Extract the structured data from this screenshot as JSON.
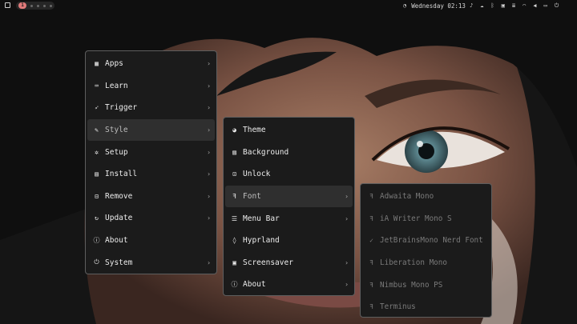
{
  "topbar": {
    "workspace_active": "1",
    "clock": "Wednesday 02:13",
    "icons": [
      "clock-icon",
      "bell-icon",
      "cloud-icon",
      "bluetooth-icon",
      "cpu-icon",
      "bars-icon",
      "wifi-icon",
      "volume-icon",
      "display-icon",
      "power-icon"
    ]
  },
  "main_menu": {
    "items": [
      {
        "label": "Apps",
        "icon": "grid-icon"
      },
      {
        "label": "Learn",
        "icon": "keyboard-icon"
      },
      {
        "label": "Trigger",
        "icon": "rocket-icon"
      },
      {
        "label": "Style",
        "icon": "brush-icon",
        "active": true
      },
      {
        "label": "Setup",
        "icon": "gear-icon"
      },
      {
        "label": "Install",
        "icon": "save-icon"
      },
      {
        "label": "Remove",
        "icon": "minus-box-icon"
      },
      {
        "label": "Update",
        "icon": "refresh-icon"
      },
      {
        "label": "About",
        "icon": "info-icon"
      },
      {
        "label": "System",
        "icon": "power-icon"
      }
    ]
  },
  "style_menu": {
    "items": [
      {
        "label": "Theme",
        "icon": "palette-icon"
      },
      {
        "label": "Background",
        "icon": "image-icon"
      },
      {
        "label": "Unlock",
        "icon": "unlock-icon"
      },
      {
        "label": "Font",
        "icon": "font-icon",
        "active": true
      },
      {
        "label": "Menu Bar",
        "icon": "menu-icon"
      },
      {
        "label": "Hyprland",
        "icon": "drop-icon"
      },
      {
        "label": "Screensaver",
        "icon": "screen-icon"
      },
      {
        "label": "About",
        "icon": "info-icon"
      }
    ]
  },
  "font_menu": {
    "items": [
      {
        "label": "Adwaita Mono",
        "icon": "font-icon"
      },
      {
        "label": "iA Writer Mono S",
        "icon": "font-icon"
      },
      {
        "label": "JetBrainsMono Nerd Font",
        "icon": "check-icon"
      },
      {
        "label": "Liberation Mono",
        "icon": "font-icon"
      },
      {
        "label": "Nimbus Mono PS",
        "icon": "font-icon"
      },
      {
        "label": "Terminus",
        "icon": "font-icon"
      }
    ]
  },
  "colors": {
    "accent": "#e07a7a",
    "menu_bg": "#1b1b1b",
    "menu_border": "#5e5e5e",
    "active_bg": "#2f2f2f"
  }
}
